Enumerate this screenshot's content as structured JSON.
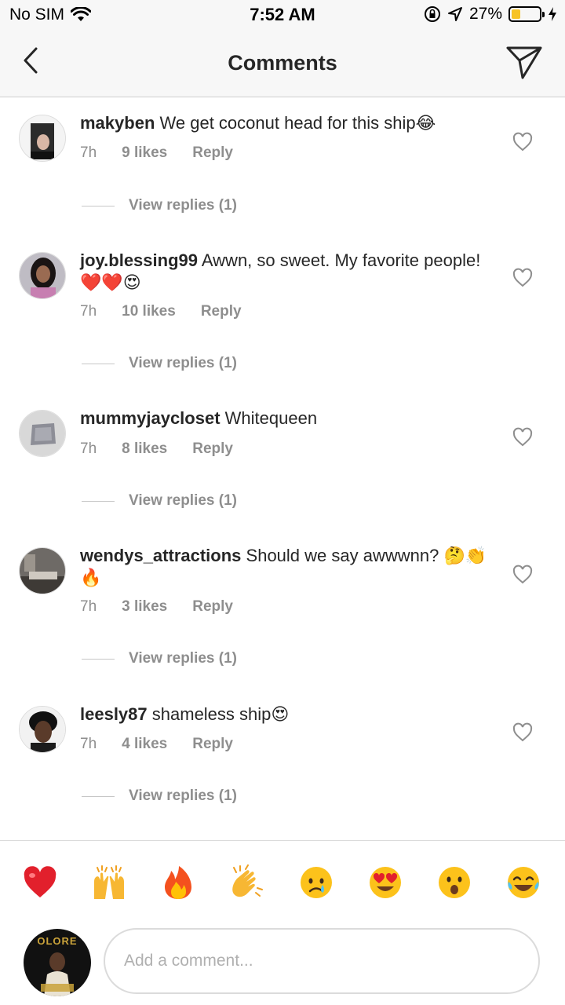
{
  "status": {
    "carrier": "No SIM",
    "time": "7:52 AM",
    "battery_text": "27%",
    "battery_level": 0.27,
    "icons": [
      "wifi-icon",
      "rotation-lock-icon",
      "location-icon",
      "battery-icon",
      "charging-icon"
    ]
  },
  "nav": {
    "title": "Comments",
    "back_icon": "chevron-left-icon",
    "send_icon": "direct-send-icon"
  },
  "comments": [
    {
      "user": "makyben",
      "text": "We get coconut head for this ship😂",
      "time": "7h",
      "likes": "9 likes",
      "reply": "Reply",
      "replies": "View replies (1)"
    },
    {
      "user": "joy.blessing99",
      "text": "Awwn, so sweet.  My favorite people! ❤️❤️😍",
      "time": "7h",
      "likes": "10 likes",
      "reply": "Reply",
      "replies": "View replies (1)"
    },
    {
      "user": "mummyjaycloset",
      "text": "Whitequeen",
      "time": "7h",
      "likes": "8 likes",
      "reply": "Reply",
      "replies": "View replies (1)"
    },
    {
      "user": "wendys_attractions",
      "text": "Should we say awwwnn? 🤔👏🔥",
      "time": "7h",
      "likes": "3 likes",
      "reply": "Reply",
      "replies": "View replies (1)"
    },
    {
      "user": "leesly87",
      "text": "shameless ship😍",
      "time": "7h",
      "likes": "4 likes",
      "reply": "Reply",
      "replies": "View replies (1)"
    }
  ],
  "quick_emojis": [
    "heart",
    "raising-hands",
    "fire",
    "clapping-hands",
    "crying-face",
    "heart-eyes",
    "astonished-face",
    "tears-of-joy"
  ],
  "composer": {
    "placeholder": "Add a comment...",
    "avatar_text": "OLORE"
  },
  "colors": {
    "text": "#262626",
    "secondary": "#8e8e8e",
    "bar_bg": "#f7f7f7",
    "battery": "#f7c325"
  }
}
